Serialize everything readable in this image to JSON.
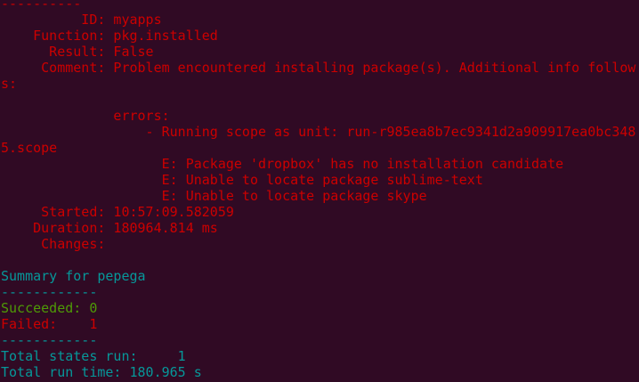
{
  "colors": {
    "background": "#300a24",
    "error_red": "#cc0000",
    "summary_cyan": "#06989a",
    "success_green": "#4e9a06"
  },
  "lines": [
    {
      "text": "----------",
      "color": "red"
    },
    {
      "text": "          ID: myapps",
      "color": "red"
    },
    {
      "text": "    Function: pkg.installed",
      "color": "red"
    },
    {
      "text": "      Result: False",
      "color": "red"
    },
    {
      "text": "     Comment: Problem encountered installing package(s). Additional info follow",
      "color": "red"
    },
    {
      "text": "s:",
      "color": "red"
    },
    {
      "text": "",
      "color": "red"
    },
    {
      "text": "              errors:",
      "color": "red"
    },
    {
      "text": "                  - Running scope as unit: run-r985ea8b7ec9341d2a909917ea0bc348",
      "color": "red"
    },
    {
      "text": "5.scope",
      "color": "red"
    },
    {
      "text": "                    E: Package 'dropbox' has no installation candidate",
      "color": "red"
    },
    {
      "text": "                    E: Unable to locate package sublime-text",
      "color": "red"
    },
    {
      "text": "                    E: Unable to locate package skype",
      "color": "red"
    },
    {
      "text": "     Started: 10:57:09.582059",
      "color": "red"
    },
    {
      "text": "    Duration: 180964.814 ms",
      "color": "red"
    },
    {
      "text": "     Changes:",
      "color": "red"
    },
    {
      "text": "",
      "color": "red"
    },
    {
      "text": "Summary for pepega",
      "color": "cyan"
    },
    {
      "text": "------------",
      "color": "cyan"
    },
    {
      "text": "Succeeded: 0",
      "color": "green"
    },
    {
      "text": "Failed:    1",
      "color": "red"
    },
    {
      "text": "------------",
      "color": "cyan"
    },
    {
      "text": "Total states run:     1",
      "color": "cyan"
    },
    {
      "text": "Total run time: 180.965 s",
      "color": "cyan"
    }
  ]
}
